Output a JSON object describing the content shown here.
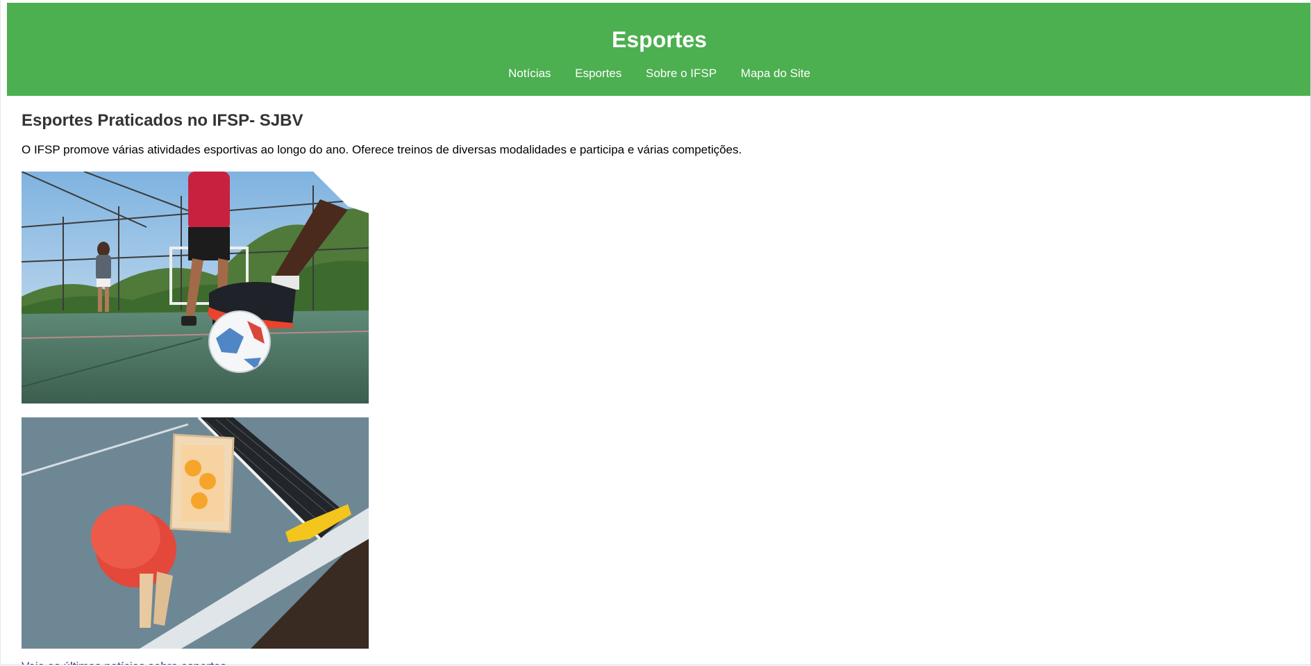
{
  "header": {
    "title": "Esportes",
    "nav": [
      "Notícias",
      "Esportes",
      "Sobre o IFSP",
      "Mapa do Site"
    ]
  },
  "main": {
    "heading": "Esportes Praticados no IFSP- SJBV",
    "intro": "O IFSP promove várias atividades esportivas ao longo do ano. Oferece treinos de diversas modalidades e participa e várias competições.",
    "images": [
      "futsal-photo",
      "table-tennis-photo"
    ],
    "link_text": "Veja as últimas notícias sobre esportes"
  },
  "colors": {
    "header_bg": "#4caf50",
    "header_text": "#ffffff",
    "heading_text": "#333333"
  }
}
